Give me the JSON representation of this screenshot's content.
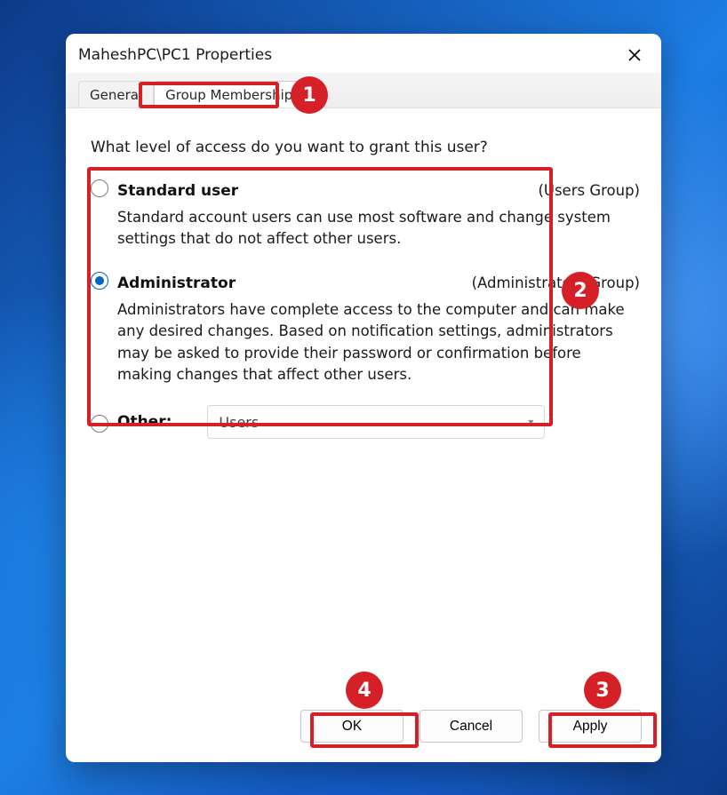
{
  "window": {
    "title": "MaheshPC\\PC1 Properties"
  },
  "tabs": {
    "general": "General",
    "group_membership": "Group Membership"
  },
  "prompt": "What level of access do you want to grant this user?",
  "options": {
    "standard": {
      "title": "Standard user",
      "group": "(Users Group)",
      "desc": "Standard account users can use most software and change system settings that do not affect other users."
    },
    "admin": {
      "title": "Administrator",
      "group": "(Administrators Group)",
      "desc": "Administrators have complete access to the computer and can make any desired changes. Based on notification settings, administrators may be asked to provide their password or confirmation before making changes that affect other users."
    },
    "other": {
      "title": "Other:",
      "select_value": "Users"
    }
  },
  "buttons": {
    "ok": "OK",
    "cancel": "Cancel",
    "apply": "Apply"
  },
  "annotations": {
    "n1": "1",
    "n2": "2",
    "n3": "3",
    "n4": "4"
  }
}
